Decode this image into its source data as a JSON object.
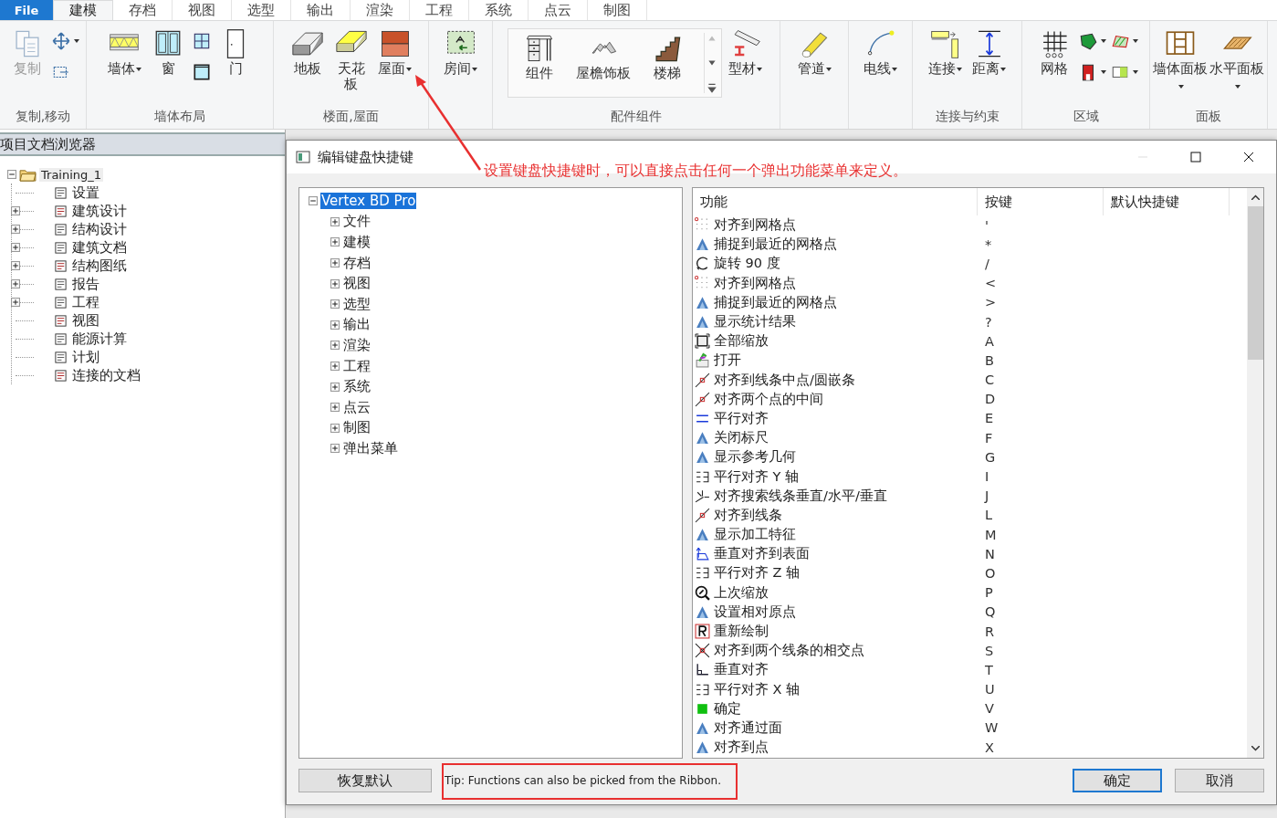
{
  "ribbon": {
    "file_tab": "File",
    "tabs": [
      {
        "label": "建模",
        "selected": true
      },
      {
        "label": "存档",
        "selected": false
      },
      {
        "label": "视图",
        "selected": false
      },
      {
        "label": "选型",
        "selected": false
      },
      {
        "label": "输出",
        "selected": false
      },
      {
        "label": "渲染",
        "selected": false
      },
      {
        "label": "工程",
        "selected": false
      },
      {
        "label": "系统",
        "selected": false
      },
      {
        "label": "点云",
        "selected": false
      },
      {
        "label": "制图",
        "selected": false
      }
    ],
    "groups": [
      {
        "label": "复制,移动",
        "tools": [
          {
            "kind": "large",
            "label": "复制",
            "dropdown": false,
            "disabled": true
          },
          {
            "kind": "small",
            "dropdown": true,
            "disabled": false
          },
          {
            "kind": "small",
            "dropdown": false,
            "disabled": false
          }
        ]
      },
      {
        "label": "墙体布局",
        "tools": [
          {
            "kind": "large",
            "label": "墙体",
            "dropdown": true,
            "disabled": false
          },
          {
            "kind": "large",
            "label": "窗",
            "dropdown": false,
            "disabled": false
          },
          {
            "kind": "small",
            "dropdown": false,
            "disabled": false
          },
          {
            "kind": "small",
            "dropdown": false,
            "disabled": false
          },
          {
            "kind": "large",
            "label": "门",
            "dropdown": false,
            "disabled": false
          }
        ]
      },
      {
        "label": "楼面,屋面",
        "tools": [
          {
            "kind": "large",
            "label": "地板",
            "dropdown": false,
            "disabled": false
          },
          {
            "kind": "large",
            "label": "天花板",
            "dropdown": false,
            "disabled": false
          },
          {
            "kind": "large",
            "label": "屋面",
            "dropdown": true,
            "disabled": false
          }
        ]
      },
      {
        "tools": [
          {
            "kind": "large",
            "label": "房间",
            "dropdown": true,
            "disabled": false
          }
        ]
      },
      {
        "label": "配件组件",
        "tools": [
          {
            "kind": "gallery",
            "label": "组件",
            "dropdown": false,
            "disabled": false
          },
          {
            "kind": "gallery",
            "label": "屋檐饰板",
            "dropdown": false,
            "disabled": false
          },
          {
            "kind": "gallery",
            "label": "楼梯",
            "dropdown": false,
            "disabled": false
          },
          {
            "kind": "large",
            "label": "型材",
            "dropdown": true,
            "disabled": false
          }
        ]
      },
      {
        "tools": [
          {
            "kind": "large",
            "label": "管道",
            "dropdown": true,
            "disabled": false
          }
        ]
      },
      {
        "tools": [
          {
            "kind": "large",
            "label": "电线",
            "dropdown": true,
            "disabled": false
          }
        ]
      },
      {
        "label": "连接与约束",
        "tools": [
          {
            "kind": "large",
            "label": "连接",
            "dropdown": true,
            "disabled": false
          },
          {
            "kind": "large",
            "label": "距离",
            "dropdown": true,
            "disabled": false
          }
        ]
      },
      {
        "label": "区域",
        "tools": [
          {
            "kind": "large",
            "label": "网格",
            "dropdown": false,
            "disabled": false
          },
          {
            "kind": "small",
            "dropdown": true,
            "disabled": false
          },
          {
            "kind": "small",
            "dropdown": true,
            "disabled": false
          },
          {
            "kind": "small",
            "dropdown": true,
            "disabled": false
          },
          {
            "kind": "small",
            "dropdown": true,
            "disabled": false
          }
        ]
      },
      {
        "label": "面板",
        "tools": [
          {
            "kind": "large",
            "label": "墙体面板",
            "dropdown": true,
            "disabled": false
          },
          {
            "kind": "large",
            "label": "水平面板",
            "dropdown": true,
            "disabled": false
          }
        ]
      }
    ]
  },
  "browser": {
    "title": "项目文档浏览器",
    "tree": [
      {
        "label": "Training_1",
        "expanded": true,
        "children": [
          {
            "label": "设置"
          },
          {
            "label": "建筑设计",
            "expanded": false
          },
          {
            "label": "结构设计",
            "expanded": false
          },
          {
            "label": "建筑文档",
            "expanded": false
          },
          {
            "label": "结构图纸",
            "expanded": false
          },
          {
            "label": "报告",
            "expanded": false
          },
          {
            "label": "工程",
            "expanded": false
          },
          {
            "label": "视图"
          },
          {
            "label": "能源计算"
          },
          {
            "label": "计划"
          },
          {
            "label": "连接的文档"
          }
        ]
      }
    ]
  },
  "annotation": {
    "note": "设置键盘快捷键时，可以直接点击任何一个弹出功能菜单来定义。"
  },
  "dialog": {
    "title": "编辑键盘快捷键",
    "tree": [
      {
        "label": "Vertex BD Pro",
        "selected": true,
        "expanded": true,
        "children": [
          {
            "label": "文件",
            "selected": false,
            "expanded": false
          },
          {
            "label": "建模",
            "selected": false,
            "expanded": false
          },
          {
            "label": "存档",
            "selected": false,
            "expanded": false
          },
          {
            "label": "视图",
            "selected": false,
            "expanded": false
          },
          {
            "label": "选型",
            "selected": false,
            "expanded": false
          },
          {
            "label": "输出",
            "selected": false,
            "expanded": false
          },
          {
            "label": "渲染",
            "selected": false,
            "expanded": false
          },
          {
            "label": "工程",
            "selected": false,
            "expanded": false
          },
          {
            "label": "系统",
            "selected": false,
            "expanded": false
          },
          {
            "label": "点云",
            "selected": false,
            "expanded": false
          },
          {
            "label": "制图",
            "selected": false,
            "expanded": false
          },
          {
            "label": "弹出菜单",
            "selected": false,
            "expanded": false
          }
        ]
      }
    ],
    "columns": [
      "功能",
      "按键",
      "默认快捷键"
    ],
    "rows": [
      {
        "kind": "dots",
        "function": "对齐到网格点",
        "key": "'"
      },
      {
        "kind": "tri",
        "function": "捕捉到最近的网格点",
        "key": "*"
      },
      {
        "kind": "rot",
        "function": "旋转 90 度",
        "key": "/"
      },
      {
        "kind": "dots",
        "function": "对齐到网格点",
        "key": "<"
      },
      {
        "kind": "tri",
        "function": "捕捉到最近的网格点",
        "key": ">"
      },
      {
        "kind": "tri",
        "function": "显示统计结果",
        "key": "?"
      },
      {
        "kind": "frame",
        "function": "全部缩放",
        "key": "A"
      },
      {
        "kind": "open",
        "function": "打开",
        "key": "B"
      },
      {
        "kind": "mid",
        "function": "对齐到线条中点/圆嵌条",
        "key": "C"
      },
      {
        "kind": "mid",
        "function": "对齐两个点的中间",
        "key": "D"
      },
      {
        "kind": "par",
        "function": "平行对齐",
        "key": "E"
      },
      {
        "kind": "tri",
        "function": "关闭标尺",
        "key": "F"
      },
      {
        "kind": "tri",
        "function": "显示参考几何",
        "key": "G"
      },
      {
        "kind": "axis",
        "function": "平行对齐 Y 轴",
        "key": "I"
      },
      {
        "kind": "search",
        "function": "对齐搜索线条垂直/水平/垂直",
        "key": "J"
      },
      {
        "kind": "mid",
        "function": "对齐到线条",
        "key": "L"
      },
      {
        "kind": "tri",
        "function": "显示加工特征",
        "key": "M"
      },
      {
        "kind": "surf",
        "function": "垂直对齐到表面",
        "key": "N"
      },
      {
        "kind": "axis",
        "function": "平行对齐 Z 轴",
        "key": "O"
      },
      {
        "kind": "zoom",
        "function": "上次缩放",
        "key": "P"
      },
      {
        "kind": "tri",
        "function": "设置相对原点",
        "key": "Q"
      },
      {
        "kind": "redraw",
        "function": "重新绘制",
        "key": "R"
      },
      {
        "kind": "cross",
        "function": "对齐到两个线条的相交点",
        "key": "S"
      },
      {
        "kind": "perp",
        "function": "垂直对齐",
        "key": "T"
      },
      {
        "kind": "axis",
        "function": "平行对齐 X 轴",
        "key": "U"
      },
      {
        "kind": "ok",
        "function": "确定",
        "key": "V"
      },
      {
        "kind": "tri",
        "function": "对齐通过面",
        "key": "W"
      },
      {
        "kind": "tri",
        "function": "对齐到点",
        "key": "X"
      }
    ],
    "restore_button": "恢复默认",
    "tip": "Tip: Functions can also be picked from the Ribbon.",
    "ok_button": "确定",
    "cancel_button": "取消"
  }
}
